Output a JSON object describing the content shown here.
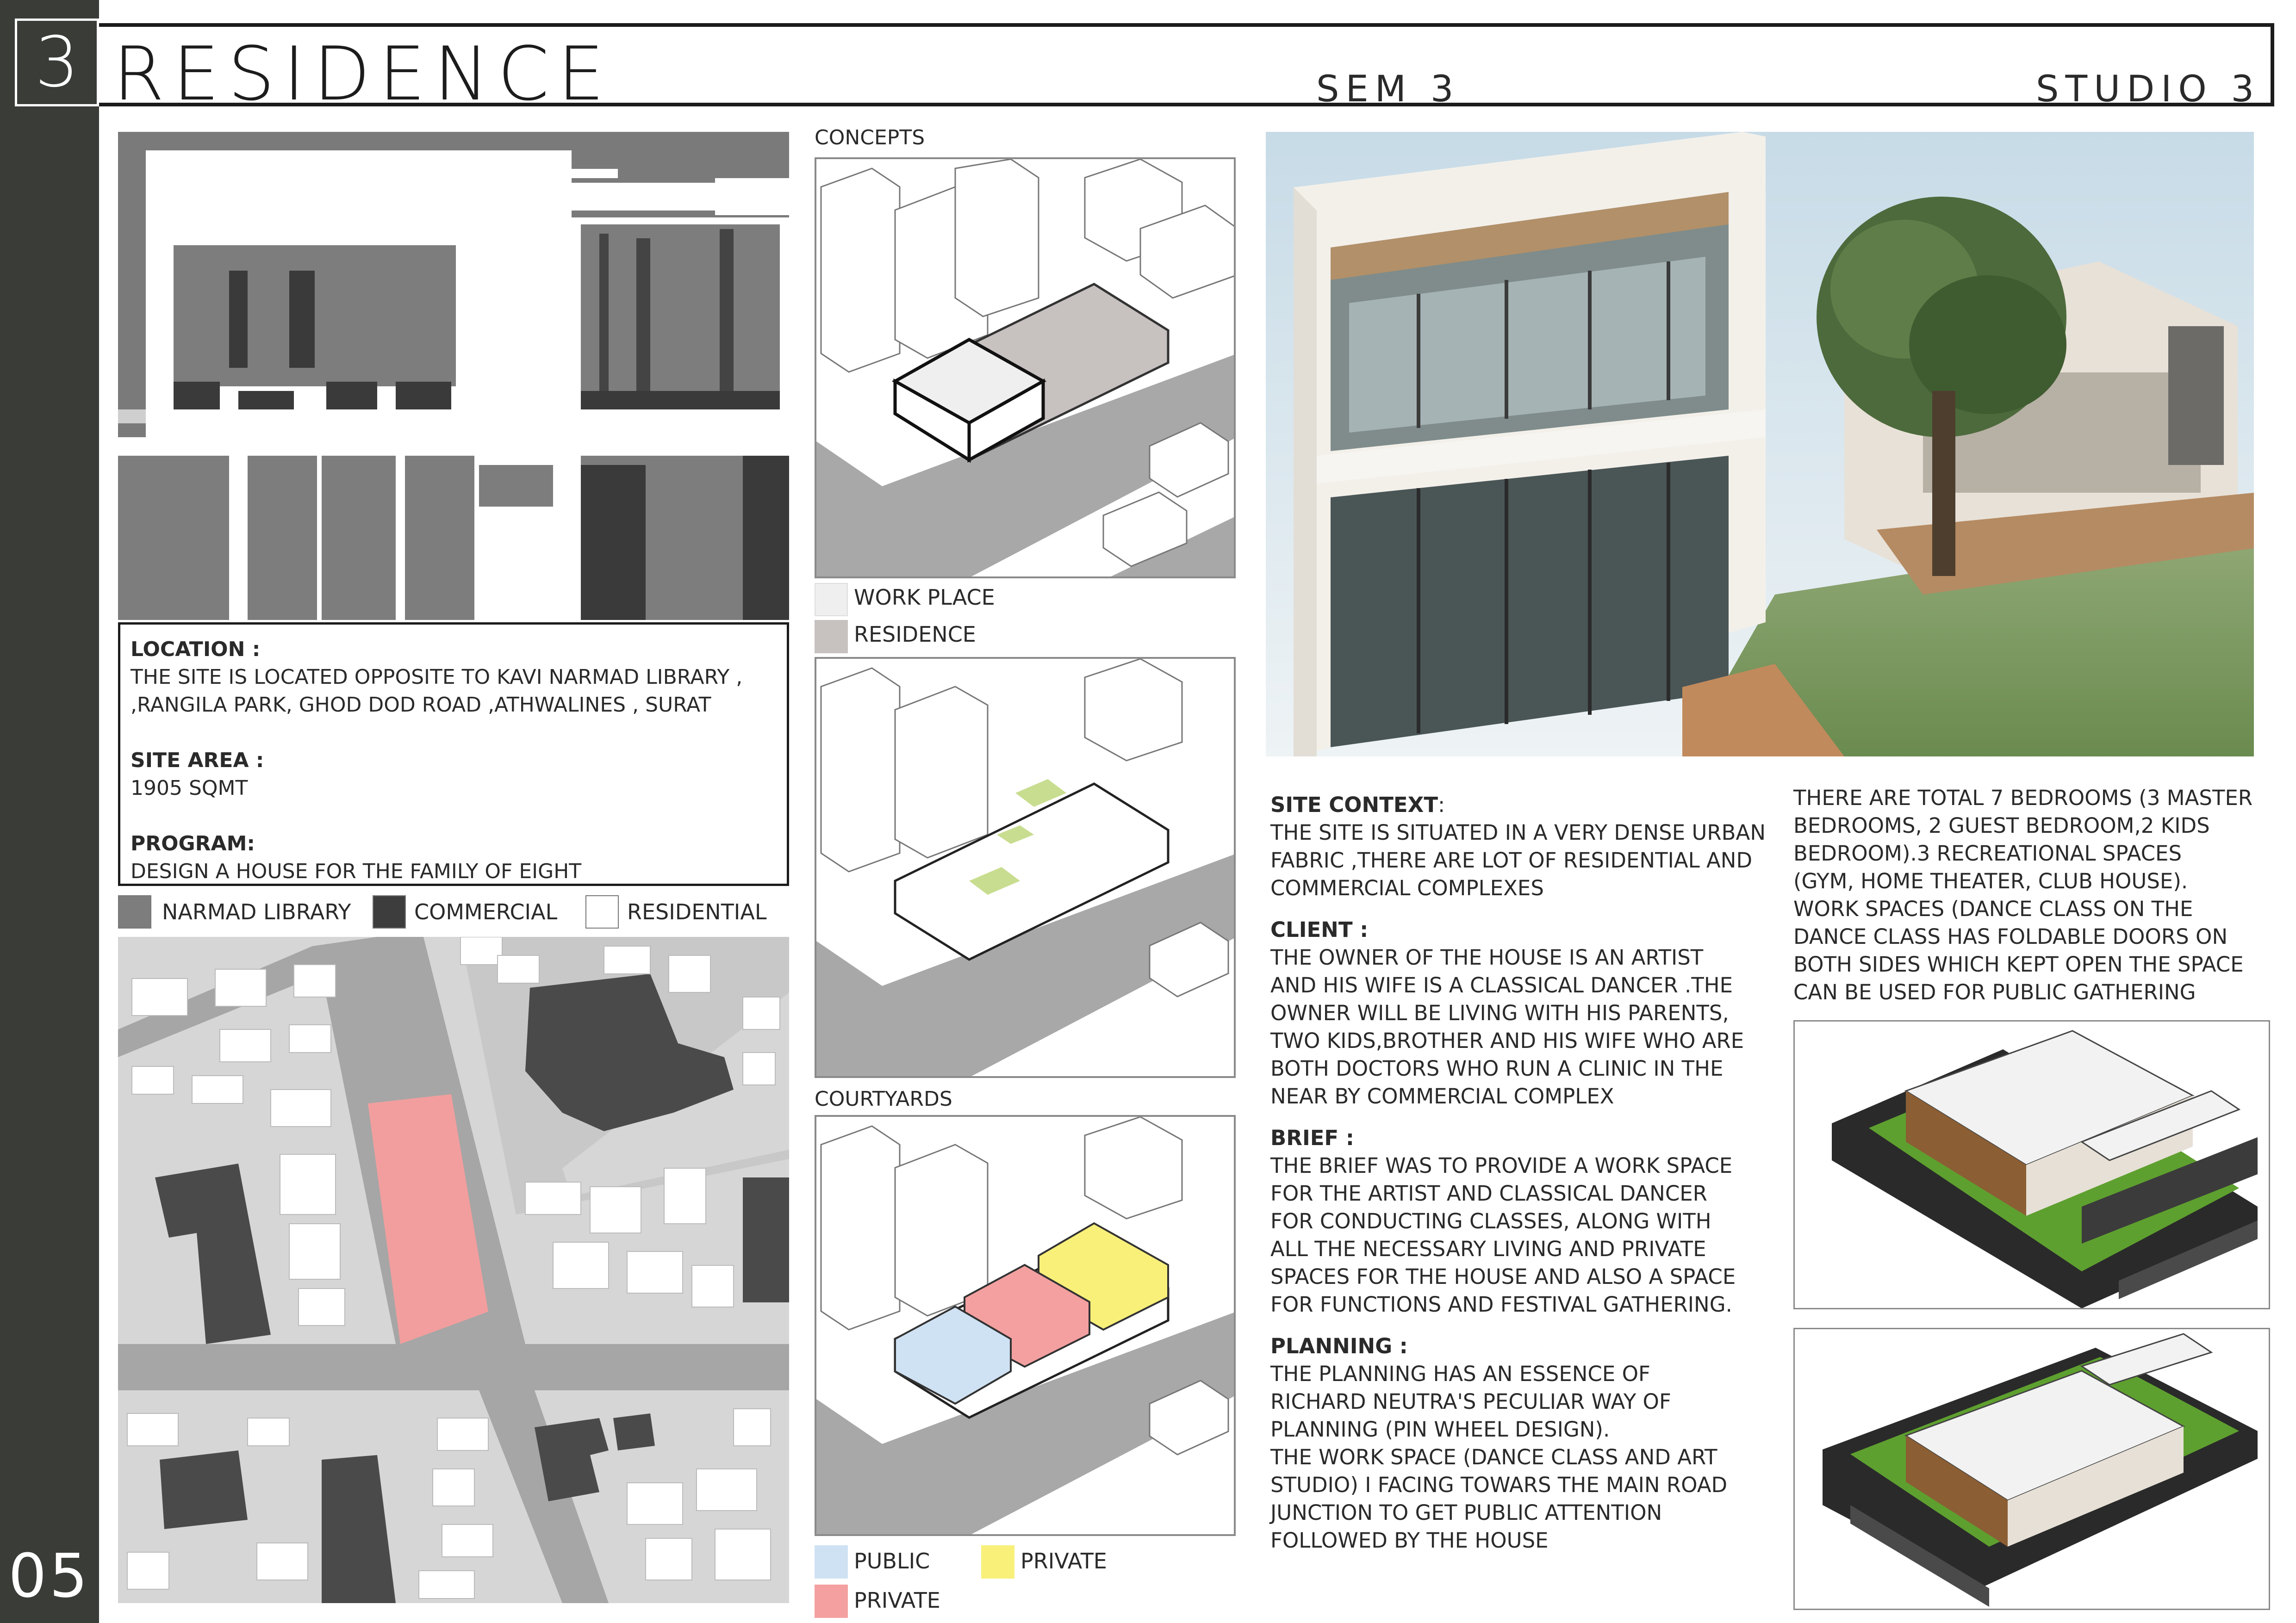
{
  "header": {
    "number": "3",
    "title": "RESIDENCE",
    "sem": "SEM 3",
    "studio": "STUDIO 3",
    "page": "05"
  },
  "info": {
    "location_heading": "LOCATION :",
    "location_line1": "THE SITE IS LOCATED OPPOSITE TO KAVI NARMAD LIBRARY ,",
    "location_line2": ",RANGILA PARK, GHOD DOD ROAD ,ATHWALINES , SURAT",
    "area_heading": "SITE AREA :",
    "area_value": "1905 SQMT",
    "program_heading": "PROGRAM:",
    "program_value": "DESIGN A HOUSE FOR THE FAMILY OF EIGHT"
  },
  "site_legend": [
    {
      "label": "NARMAD LIBRARY",
      "color": "#7d7d7d"
    },
    {
      "label": "COMMERCIAL",
      "color": "#3d3d3d"
    },
    {
      "label": "RESIDENTIAL",
      "color": "#ffffff"
    }
  ],
  "concepts": {
    "heading": "CONCEPTS",
    "legend": [
      {
        "label": "WORK PLACE",
        "color": "#efefef"
      },
      {
        "label": "RESIDENCE",
        "color": "#c7c1c0"
      }
    ]
  },
  "courtyards": {
    "heading": "COURTYARDS",
    "legend": [
      {
        "label": "PUBLIC",
        "color": "#cfe2f3"
      },
      {
        "label": "PRIVATE",
        "color": "#f9f07a"
      },
      {
        "label": "PRIVATE",
        "color": "#f4a0a0"
      }
    ]
  },
  "text": {
    "site_context_heading": "SITE CONTEXT",
    "site_context_colon": ":",
    "site_context": [
      "THE SITE IS SITUATED IN A VERY DENSE URBAN",
      "FABRIC ,THERE ARE LOT OF RESIDENTIAL AND",
      "COMMERCIAL COMPLEXES"
    ],
    "client_heading": "CLIENT :",
    "client": [
      "THE OWNER OF THE HOUSE IS AN ARTIST",
      "AND HIS WIFE IS A CLASSICAL DANCER .THE",
      "OWNER WILL BE LIVING WITH HIS PARENTS,",
      "TWO KIDS,BROTHER AND HIS WIFE WHO ARE",
      "BOTH DOCTORS WHO RUN A CLINIC IN THE",
      "NEAR BY COMMERCIAL COMPLEX"
    ],
    "brief_heading": "BRIEF :",
    "brief": [
      "THE BRIEF WAS TO PROVIDE A WORK SPACE",
      "FOR THE ARTIST AND CLASSICAL DANCER",
      "FOR CONDUCTING CLASSES, ALONG WITH",
      "ALL THE NECESSARY LIVING AND PRIVATE",
      "SPACES FOR THE HOUSE AND ALSO A SPACE",
      "FOR FUNCTIONS AND FESTIVAL GATHERING."
    ],
    "planning_heading": "PLANNING :",
    "planning": [
      "THE PLANNING HAS AN ESSENCE OF",
      "RICHARD NEUTRA'S PECULIAR WAY OF",
      "PLANNING (PIN WHEEL DESIGN).",
      "THE WORK SPACE (DANCE CLASS AND ART",
      "STUDIO) I FACING TOWARS THE MAIN ROAD",
      "JUNCTION TO GET PUBLIC ATTENTION",
      "FOLLOWED BY THE HOUSE"
    ],
    "bedrooms": [
      "THERE ARE TOTAL 7 BEDROOMS (3 MASTER",
      "BEDROOMS, 2 GUEST BEDROOM,2 KIDS",
      "BEDROOM).3 RECREATIONAL SPACES",
      "(GYM, HOME THEATER, CLUB HOUSE).",
      "WORK SPACES (DANCE CLASS ON THE",
      "DANCE CLASS HAS FOLDABLE DOORS  ON",
      "BOTH SIDES WHICH KEPT OPEN THE SPACE",
      "CAN BE USED FOR PUBLIC GATHERING"
    ]
  }
}
